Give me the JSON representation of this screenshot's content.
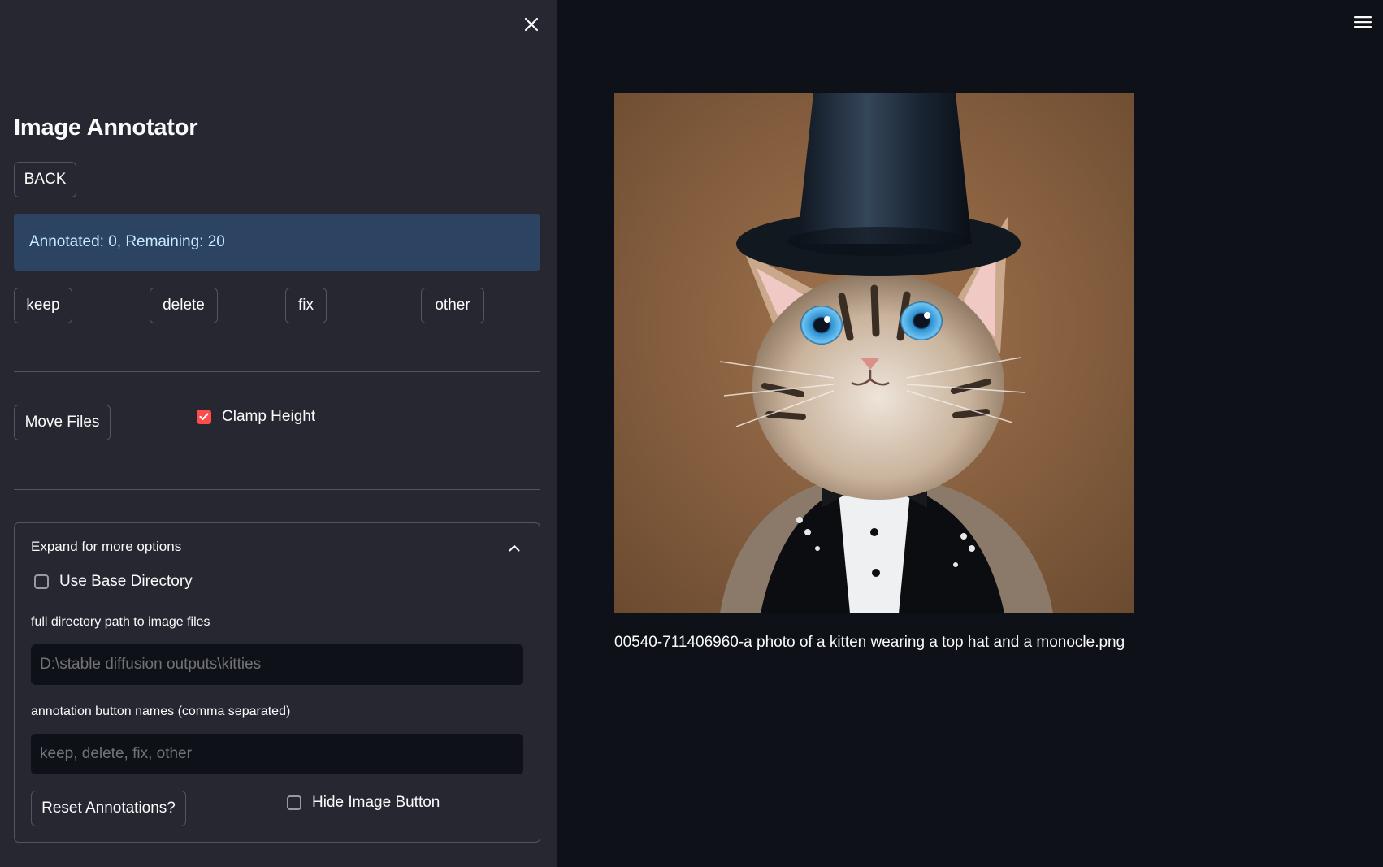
{
  "sidebar": {
    "title": "Image Annotator",
    "back_label": "BACK",
    "status_text": "Annotated: 0, Remaining: 20",
    "annotation_buttons": [
      "keep",
      "delete",
      "fix",
      "other"
    ],
    "move_files_label": "Move Files",
    "clamp_height": {
      "label": "Clamp Height",
      "checked": true
    },
    "expander": {
      "title": "Expand for more options",
      "expanded": true,
      "use_base_directory": {
        "label": "Use Base Directory",
        "checked": false
      },
      "directory_path": {
        "label": "full directory path to image files",
        "placeholder": "D:\\stable diffusion outputs\\kitties",
        "value": ""
      },
      "button_names": {
        "label": "annotation button names (comma separated)",
        "placeholder": "keep, delete, fix, other",
        "value": ""
      },
      "reset_label": "Reset Annotations?",
      "hide_image_button": {
        "label": "Hide Image Button",
        "checked": false
      }
    }
  },
  "main": {
    "image_caption": "00540-711406960-a photo of a kitten wearing a top hat and a monocle.png"
  },
  "icons": {
    "close": "close-icon",
    "menu": "hamburger-menu-icon",
    "chevron": "chevron-up-icon",
    "check": "checkmark-icon"
  },
  "colors": {
    "sidebar_bg": "#262730",
    "main_bg": "#0e1117",
    "info_bg": "#2c4461",
    "info_text": "#c7ebff",
    "accent": "#ff4b4b"
  }
}
